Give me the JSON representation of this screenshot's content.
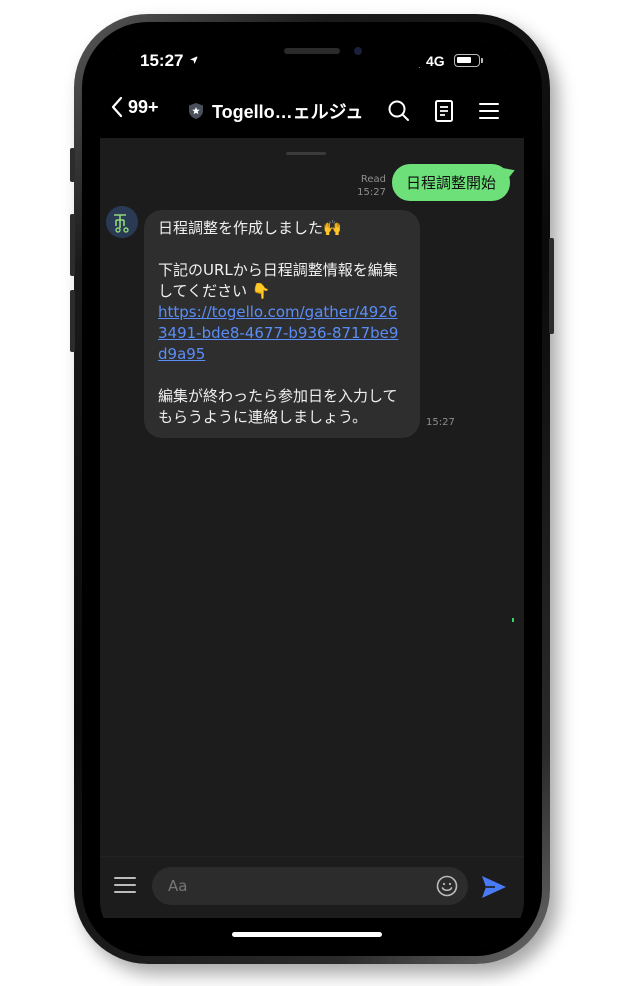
{
  "status_bar": {
    "time": "15:27",
    "network": "4G",
    "battery_level": 0.75
  },
  "header": {
    "back_count": "99+",
    "title": "Togello…ェルジュ"
  },
  "messages": {
    "outgoing": {
      "text": "日程調整開始",
      "read": "Read",
      "time": "15:27"
    },
    "incoming": {
      "line1": "日程調整を作成しました🙌",
      "line2": "下記のURLから日程調整情報を編集してください 👇",
      "link": "https://togello.com/gather/49263491-bde8-4677-b936-8717be9d9a95",
      "line3": "編集が終わったら参加日を入力してもらうように連絡しましょう。",
      "time": "15:27"
    }
  },
  "input": {
    "placeholder": "Aa",
    "value": ""
  },
  "colors": {
    "outgoing_bubble": "#6de07a",
    "link": "#5b8df6",
    "send": "#4a7bf7",
    "incoming_bubble": "#2e2e2e"
  }
}
